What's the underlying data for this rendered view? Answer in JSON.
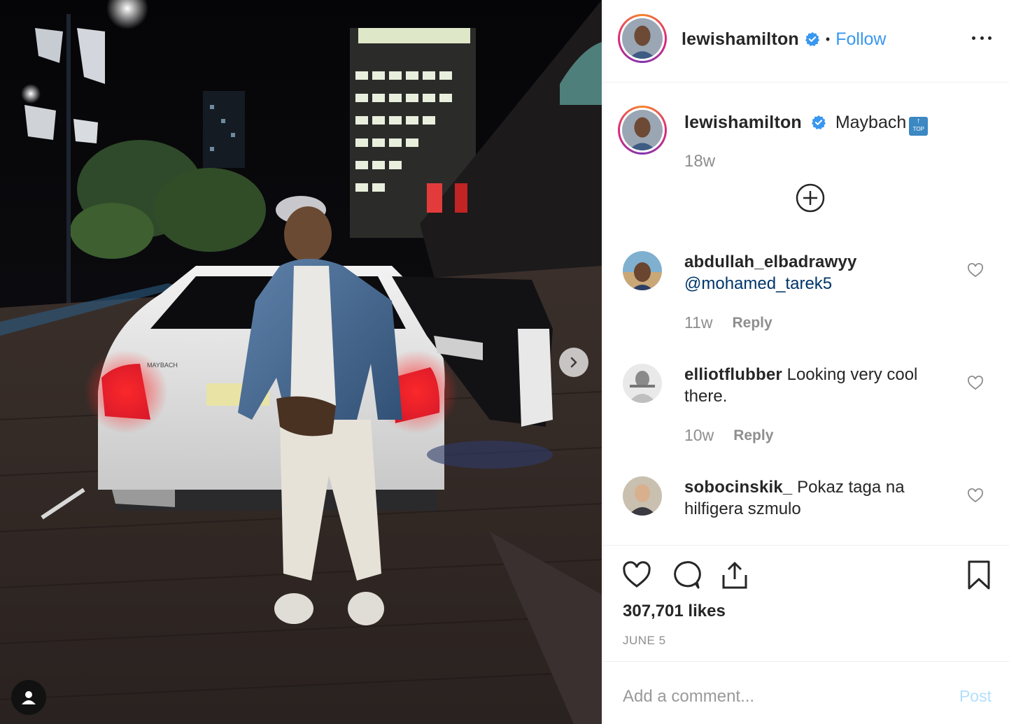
{
  "photo": {
    "car_badge": "MAYBACH",
    "next_icon": "chevron-right-icon",
    "tag_icon": "user-tag-icon"
  },
  "header": {
    "username": "lewishamilton",
    "separator": "•",
    "follow_label": "Follow",
    "more_icon": "more-horizontal-icon"
  },
  "caption": {
    "username": "lewishamilton",
    "text": "Maybach",
    "emoji_label": "TOP",
    "time": "18w"
  },
  "comments": [
    {
      "username": "abdullah_elbadrawyy",
      "text": "",
      "mention": "@mohamed_tarek5",
      "time": "11w",
      "reply_label": "Reply"
    },
    {
      "username": "elliotflubber",
      "text": "Looking very cool there.",
      "mention": "",
      "time": "10w",
      "reply_label": "Reply"
    },
    {
      "username": "sobocinskik_",
      "text": "Pokaz taga na hilfigera szmulo",
      "mention": "",
      "time": "",
      "reply_label": ""
    }
  ],
  "actions": {
    "likes": "307,701 likes",
    "date": "JUNE 5"
  },
  "add_comment": {
    "placeholder": "Add a comment...",
    "post_label": "Post"
  },
  "colors": {
    "accent": "#3897f0",
    "verified": "#3897f0",
    "muted": "#8e8e8e",
    "post_disabled": "#b2dffc"
  }
}
